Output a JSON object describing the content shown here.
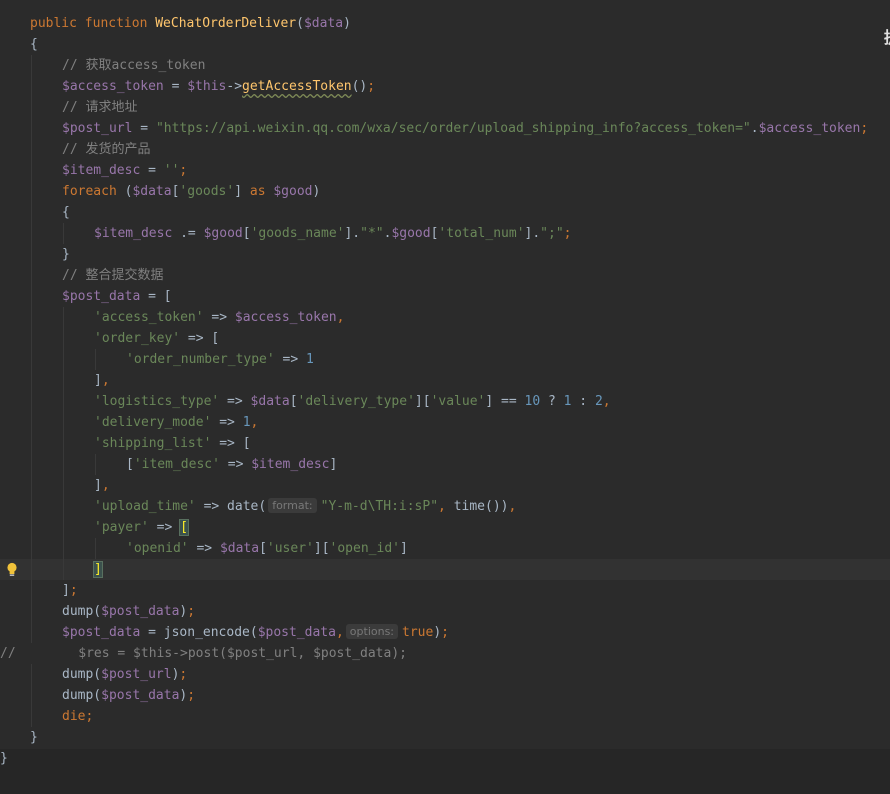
{
  "editor": {
    "edge_glyph": "提",
    "hints": {
      "format": "format:",
      "options": "options:"
    },
    "lines": [
      {
        "t": [
          [
            "kw",
            "public function "
          ],
          [
            "fn",
            "WeChatOrderDeliver"
          ],
          [
            "p",
            "("
          ],
          [
            "var",
            "$data"
          ],
          [
            "p",
            ")"
          ]
        ]
      },
      {
        "t": [
          [
            "p",
            "{"
          ]
        ]
      },
      {
        "t": [
          [
            "cmt",
            "// 获取access_token"
          ]
        ]
      },
      {
        "t": [
          [
            "var",
            "$access_token"
          ],
          [
            "p",
            " = "
          ],
          [
            "var",
            "$this"
          ],
          [
            "p",
            "->"
          ],
          [
            "ul",
            "getAccessToken"
          ],
          [
            "p",
            "()"
          ],
          [
            "kw",
            ";"
          ]
        ]
      },
      {
        "t": [
          [
            "cmt",
            "// 请求地址"
          ]
        ]
      },
      {
        "t": [
          [
            "var",
            "$post_url"
          ],
          [
            "p",
            " = "
          ],
          [
            "str",
            "\"https://api.weixin.qq.com/wxa/sec/order/upload_shipping_info?access_token=\""
          ],
          [
            "p",
            "."
          ],
          [
            "var",
            "$access_token"
          ],
          [
            "kw",
            ";"
          ]
        ]
      },
      {
        "t": [
          [
            "cmt",
            "// 发货的产品"
          ]
        ]
      },
      {
        "t": [
          [
            "var",
            "$item_desc"
          ],
          [
            "p",
            " = "
          ],
          [
            "str",
            "''"
          ],
          [
            "kw",
            ";"
          ]
        ]
      },
      {
        "t": [
          [
            "kw",
            "foreach "
          ],
          [
            "p",
            "("
          ],
          [
            "var",
            "$data"
          ],
          [
            "p",
            "["
          ],
          [
            "str",
            "'goods'"
          ],
          [
            "p",
            "] "
          ],
          [
            "kw",
            "as "
          ],
          [
            "var",
            "$good"
          ],
          [
            "p",
            ")"
          ]
        ]
      },
      {
        "t": [
          [
            "p",
            "{"
          ]
        ]
      },
      {
        "t": [
          [
            "var",
            "$item_desc"
          ],
          [
            "p",
            " .= "
          ],
          [
            "var",
            "$good"
          ],
          [
            "p",
            "["
          ],
          [
            "str",
            "'goods_name'"
          ],
          [
            "p",
            "]."
          ],
          [
            "str",
            "\"*\""
          ],
          [
            "p",
            "."
          ],
          [
            "var",
            "$good"
          ],
          [
            "p",
            "["
          ],
          [
            "str",
            "'total_num'"
          ],
          [
            "p",
            "]."
          ],
          [
            "str",
            "\";\""
          ],
          [
            "kw",
            ";"
          ]
        ]
      },
      {
        "t": [
          [
            "p",
            "}"
          ]
        ]
      },
      {
        "t": [
          [
            "cmt",
            "// 整合提交数据"
          ]
        ]
      },
      {
        "t": [
          [
            "var",
            "$post_data"
          ],
          [
            "p",
            " = ["
          ]
        ]
      },
      {
        "t": [
          [
            "str",
            "'access_token'"
          ],
          [
            "p",
            " => "
          ],
          [
            "var",
            "$access_token"
          ],
          [
            "kw",
            ","
          ]
        ]
      },
      {
        "t": [
          [
            "str",
            "'order_key'"
          ],
          [
            "p",
            " => ["
          ]
        ]
      },
      {
        "t": [
          [
            "str",
            "'order_number_type'"
          ],
          [
            "p",
            " => "
          ],
          [
            "num",
            "1"
          ]
        ]
      },
      {
        "t": [
          [
            "p",
            "]"
          ],
          [
            "kw",
            ","
          ]
        ]
      },
      {
        "t": [
          [
            "str",
            "'logistics_type'"
          ],
          [
            "p",
            " => "
          ],
          [
            "var",
            "$data"
          ],
          [
            "p",
            "["
          ],
          [
            "str",
            "'delivery_type'"
          ],
          [
            "p",
            "]["
          ],
          [
            "str",
            "'value'"
          ],
          [
            "p",
            "] == "
          ],
          [
            "num",
            "10"
          ],
          [
            "p",
            " ? "
          ],
          [
            "num",
            "1"
          ],
          [
            "p",
            " : "
          ],
          [
            "num",
            "2"
          ],
          [
            "kw",
            ","
          ]
        ]
      },
      {
        "t": [
          [
            "str",
            "'delivery_mode'"
          ],
          [
            "p",
            " => "
          ],
          [
            "num",
            "1"
          ],
          [
            "kw",
            ","
          ]
        ]
      },
      {
        "t": [
          [
            "str",
            "'shipping_list'"
          ],
          [
            "p",
            " => ["
          ]
        ]
      },
      {
        "t": [
          [
            "p",
            "["
          ],
          [
            "str",
            "'item_desc'"
          ],
          [
            "p",
            " => "
          ],
          [
            "var",
            "$item_desc"
          ],
          [
            "p",
            "]"
          ]
        ]
      },
      {
        "t": [
          [
            "p",
            "]"
          ],
          [
            "kw",
            ","
          ]
        ]
      },
      {
        "t": [
          [
            "str",
            "'upload_time'"
          ],
          [
            "p",
            " => date("
          ],
          [
            "hint",
            "format"
          ],
          [
            "str",
            "\"Y-m-d\\TH:i:sP\""
          ],
          [
            "kw",
            ", "
          ],
          [
            "p",
            "time())"
          ],
          [
            "kw",
            ","
          ]
        ]
      },
      {
        "t": [
          [
            "str",
            "'payer'"
          ],
          [
            "p",
            " => "
          ],
          [
            "br",
            "["
          ]
        ]
      },
      {
        "t": [
          [
            "str",
            "'openid'"
          ],
          [
            "p",
            " => "
          ],
          [
            "var",
            "$data"
          ],
          [
            "p",
            "["
          ],
          [
            "str",
            "'user'"
          ],
          [
            "p",
            "]["
          ],
          [
            "str",
            "'open_id'"
          ],
          [
            "p",
            "]"
          ]
        ]
      },
      {
        "t": [
          [
            "br",
            "]"
          ]
        ]
      },
      {
        "t": [
          [
            "p",
            "]"
          ],
          [
            "kw",
            ";"
          ]
        ]
      },
      {
        "t": [
          [
            "p",
            "dump("
          ],
          [
            "var",
            "$post_data"
          ],
          [
            "p",
            ")"
          ],
          [
            "kw",
            ";"
          ]
        ]
      },
      {
        "t": [
          [
            "var",
            "$post_data"
          ],
          [
            "p",
            " = json_encode("
          ],
          [
            "var",
            "$post_data"
          ],
          [
            "kw",
            ","
          ],
          [
            "hint",
            "options"
          ],
          [
            "kw",
            "true"
          ],
          [
            "p",
            ")"
          ],
          [
            "kw",
            ";"
          ]
        ]
      },
      {
        "t": [
          [
            "cm",
            "//        $res = $this->post($post_url, $post_data);"
          ]
        ]
      },
      {
        "t": [
          [
            "p",
            "dump("
          ],
          [
            "var",
            "$post_url"
          ],
          [
            "p",
            ")"
          ],
          [
            "kw",
            ";"
          ]
        ]
      },
      {
        "t": [
          [
            "p",
            "dump("
          ],
          [
            "var",
            "$post_data"
          ],
          [
            "p",
            ")"
          ],
          [
            "kw",
            ";"
          ]
        ]
      },
      {
        "t": [
          [
            "kw",
            "die;"
          ]
        ]
      },
      {
        "t": [
          [
            "p",
            "}"
          ]
        ]
      },
      {
        "t": [
          [
            "p",
            "}"
          ]
        ]
      }
    ]
  }
}
